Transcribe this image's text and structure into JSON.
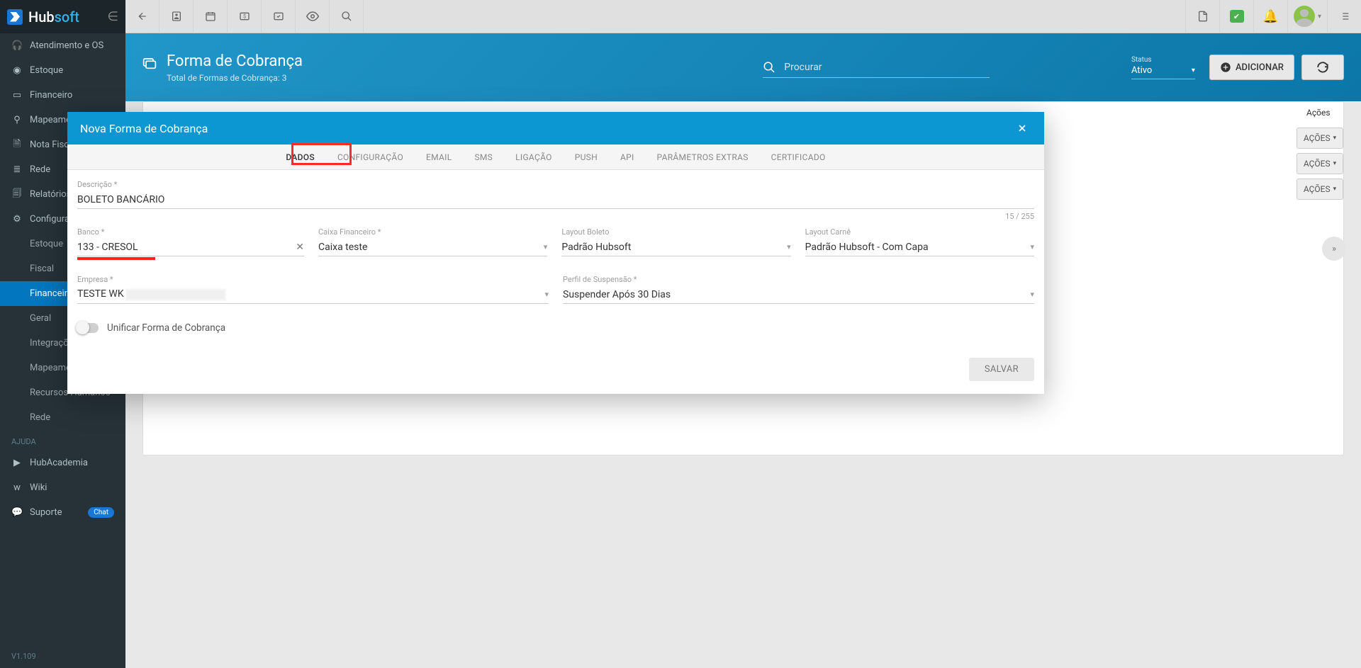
{
  "brand": {
    "hub": "Hub",
    "soft": "soft"
  },
  "sidebar": {
    "main": [
      {
        "label": "Atendimento e OS",
        "icon": "headset-icon"
      },
      {
        "label": "Estoque",
        "icon": "cube-icon"
      },
      {
        "label": "Financeiro",
        "icon": "wallet-icon"
      },
      {
        "label": "Mapeamento",
        "icon": "pin-icon"
      },
      {
        "label": "Nota Fiscal",
        "icon": "file-icon"
      },
      {
        "label": "Rede",
        "icon": "network-icon"
      },
      {
        "label": "Relatórios",
        "icon": "report-icon"
      },
      {
        "label": "Configurações",
        "icon": "gear-icon"
      }
    ],
    "sub": [
      {
        "label": "Estoque"
      },
      {
        "label": "Fiscal"
      },
      {
        "label": "Financeiro",
        "active": true
      },
      {
        "label": "Geral"
      },
      {
        "label": "Integrações"
      },
      {
        "label": "Mapeamento"
      },
      {
        "label": "Recursos Humanos"
      },
      {
        "label": "Rede"
      }
    ],
    "helpLabel": "AJUDA",
    "help": [
      {
        "label": "HubAcademia",
        "icon": "youtube-icon"
      },
      {
        "label": "Wiki",
        "icon": "wiki-icon"
      },
      {
        "label": "Suporte",
        "icon": "chat-icon",
        "badge": "Chat"
      }
    ],
    "version": "V1.109"
  },
  "page": {
    "title": "Forma de Cobrança",
    "subtitle": "Total de Formas de Cobrança: 3",
    "searchPlaceholder": "Procurar",
    "statusLabel": "Status",
    "statusValue": "Ativo",
    "addLabel": "ADICIONAR",
    "actionsHeader": "Ações",
    "actionsBtn": "AÇÕES"
  },
  "modal": {
    "title": "Nova Forma de Cobrança",
    "tabs": [
      "DADOS",
      "CONFIGURAÇÃO",
      "EMAIL",
      "SMS",
      "LIGAÇÃO",
      "PUSH",
      "API",
      "PARÂMETROS EXTRAS",
      "CERTIFICADO"
    ],
    "activeTab": 0,
    "fields": {
      "descricao": {
        "label": "Descrição *",
        "value": "BOLETO BANCÁRIO",
        "counter": "15 / 255"
      },
      "banco": {
        "label": "Banco *",
        "value": "133 - CRESOL"
      },
      "caixa": {
        "label": "Caixa Financeiro *",
        "value": "Caixa teste"
      },
      "layoutBoleto": {
        "label": "Layout Boleto",
        "value": "Padrão Hubsoft"
      },
      "layoutCarne": {
        "label": "Layout Carnê",
        "value": "Padrão Hubsoft - Com Capa"
      },
      "empresa": {
        "label": "Empresa *",
        "value": "TESTE WK"
      },
      "perfilSuspensao": {
        "label": "Perfil de Suspensão *",
        "value": "Suspender Após 30 Dias"
      }
    },
    "toggleLabel": "Unificar Forma de Cobrança",
    "saveLabel": "SALVAR"
  }
}
